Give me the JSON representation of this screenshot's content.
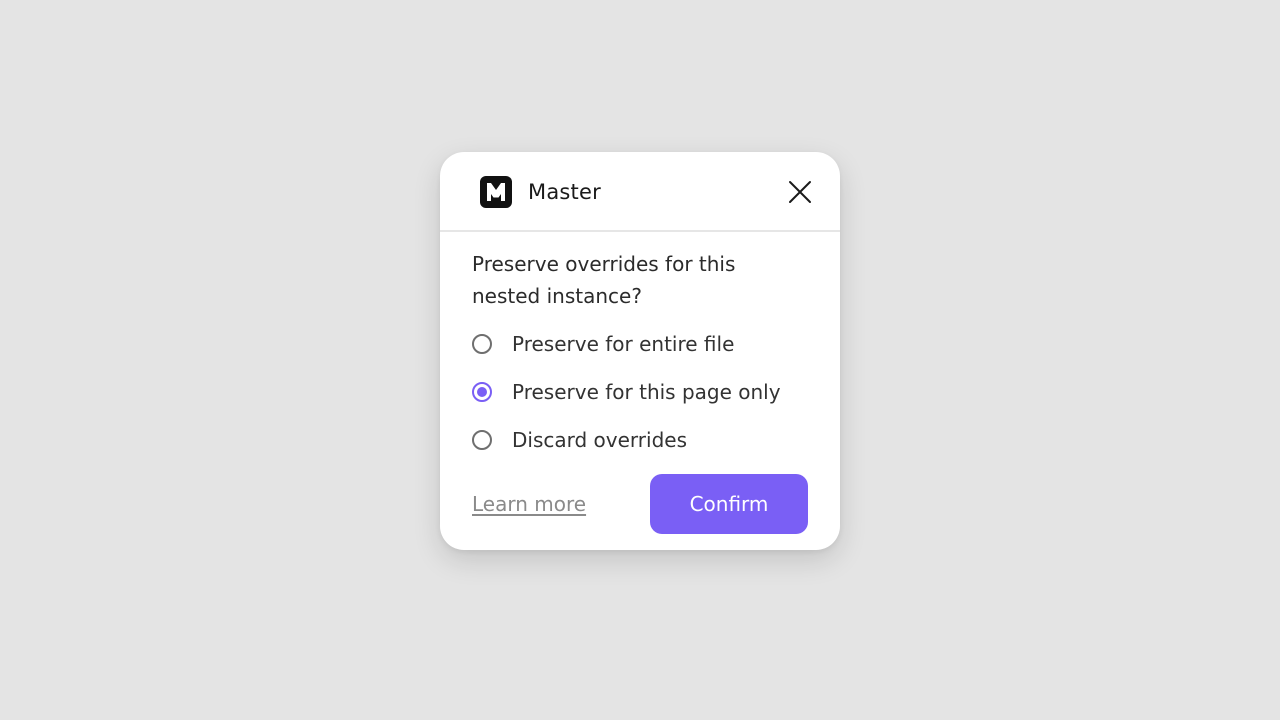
{
  "dialog": {
    "app_name": "Master",
    "logo_icon": "m-logo-icon",
    "close_icon": "close-icon",
    "question": "Preserve overrides for this nested instance?",
    "options": [
      {
        "label": "Preserve for entire file",
        "selected": false
      },
      {
        "label": "Preserve for this page only",
        "selected": true
      },
      {
        "label": "Discard overrides",
        "selected": false
      }
    ],
    "learn_more": "Learn more",
    "confirm": "Confirm"
  },
  "colors": {
    "accent": "#7a5ff5",
    "background": "#e4e4e4",
    "dialog": "#ffffff",
    "link": "#8a8a8a"
  }
}
